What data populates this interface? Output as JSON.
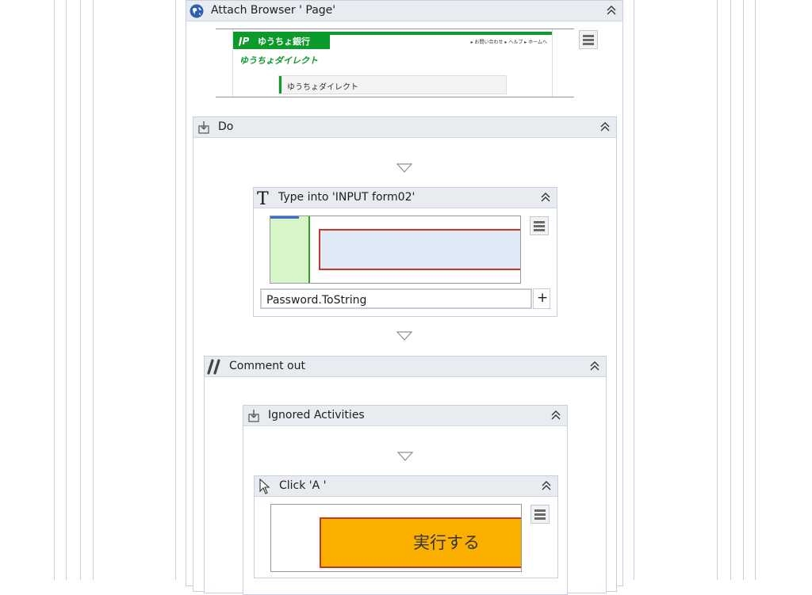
{
  "attach_browser": {
    "title": "Attach Browser '           Page'"
  },
  "preview_page": {
    "bank_name": "ゆうちょ銀行",
    "top_links": "▸ お問い合わせ ▸ ヘルプ ▸ ホームへ",
    "direct_logo": "ゆうちょダイレクト",
    "nav_item": "ゆうちょダイレクト"
  },
  "do": {
    "title": "Do"
  },
  "type_into": {
    "title": "Type into 'INPUT  form02'",
    "text_value": "Password.ToString",
    "plus_label": "+"
  },
  "comment_out": {
    "title": "Comment out"
  },
  "ignored": {
    "title": "Ignored Activities"
  },
  "click": {
    "title": "Click 'A '",
    "button_text": "実行する"
  },
  "colors": {
    "header_bg": "#e8ebf0",
    "border": "#c9cfe0",
    "bank_green": "#0c9a2a",
    "selection_red": "#c0392b",
    "click_orange": "#fbb000"
  }
}
